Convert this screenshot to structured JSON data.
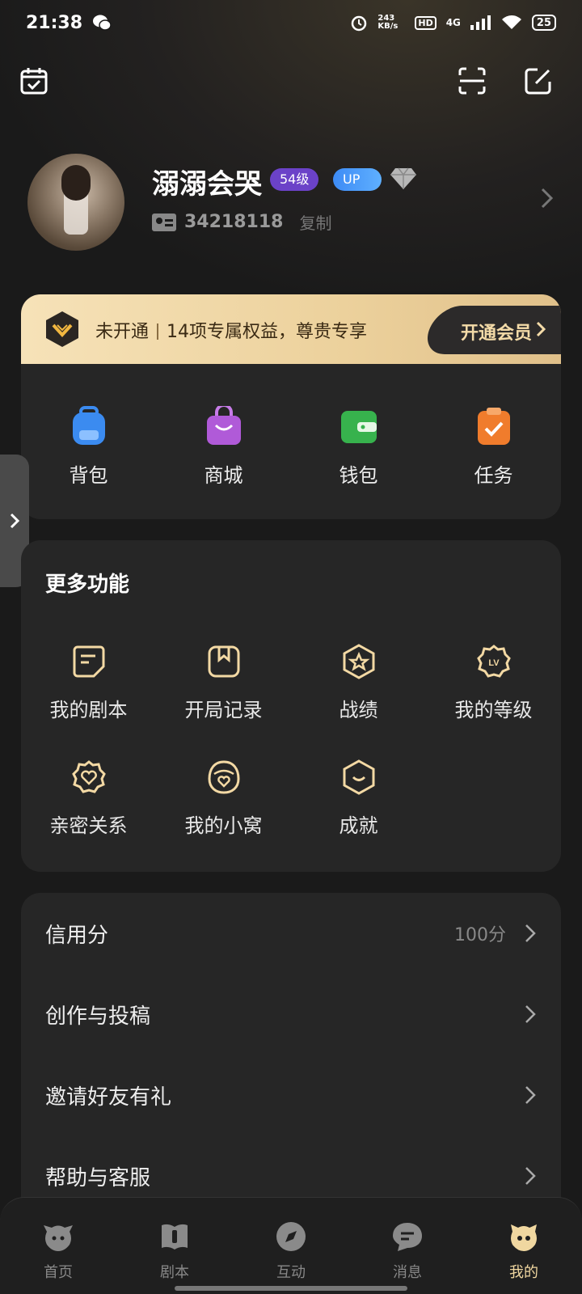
{
  "status_bar": {
    "time": "21:38",
    "net_speed": "243 KB/s",
    "hd": "HD",
    "signal": "4G",
    "battery": "25"
  },
  "header": {
    "left_icon": "calendar-check-icon",
    "right_icons": [
      "scan-icon",
      "edit-icon"
    ]
  },
  "profile": {
    "nickname": "溺溺会哭",
    "level_badge": "54级",
    "up_badge": "UP",
    "user_id": "34218118",
    "copy_label": "复制"
  },
  "vip": {
    "status": "未开通",
    "benefits": "14项专属权益，尊贵专享",
    "button_label": "开通会员"
  },
  "quick_actions": [
    {
      "label": "背包",
      "icon": "backpack-icon",
      "color": "#3b8bf0"
    },
    {
      "label": "商城",
      "icon": "shopping-bag-icon",
      "color": "#b05ad8"
    },
    {
      "label": "钱包",
      "icon": "wallet-icon",
      "color": "#37b24d"
    },
    {
      "label": "任务",
      "icon": "task-clipboard-icon",
      "color": "#f07c2c"
    }
  ],
  "more_features": {
    "title": "更多功能",
    "items": [
      {
        "label": "我的剧本",
        "icon": "script-icon"
      },
      {
        "label": "开局记录",
        "icon": "bookmark-record-icon"
      },
      {
        "label": "战绩",
        "icon": "star-badge-icon"
      },
      {
        "label": "我的等级",
        "icon": "level-badge-icon",
        "badge_text": "LV"
      },
      {
        "label": "亲密关系",
        "icon": "heart-flower-icon"
      },
      {
        "label": "我的小窝",
        "icon": "heart-home-icon"
      },
      {
        "label": "成就",
        "icon": "smile-hexagon-icon"
      }
    ]
  },
  "settings_list": [
    {
      "label": "信用分",
      "value": "100分"
    },
    {
      "label": "创作与投稿",
      "value": ""
    },
    {
      "label": "邀请好友有礼",
      "value": ""
    },
    {
      "label": "帮助与客服",
      "value": ""
    }
  ],
  "tab_bar": {
    "tabs": [
      {
        "label": "首页",
        "icon": "home-mascot-icon",
        "active": false
      },
      {
        "label": "剧本",
        "icon": "book-icon",
        "active": false
      },
      {
        "label": "互动",
        "icon": "compass-icon",
        "active": false
      },
      {
        "label": "消息",
        "icon": "message-icon",
        "active": false
      },
      {
        "label": "我的",
        "icon": "profile-mascot-icon",
        "active": true
      }
    ]
  },
  "colors": {
    "accent_gold": "#f0d7a0",
    "panel_bg": "#262626",
    "page_bg": "#1a1a1a"
  }
}
